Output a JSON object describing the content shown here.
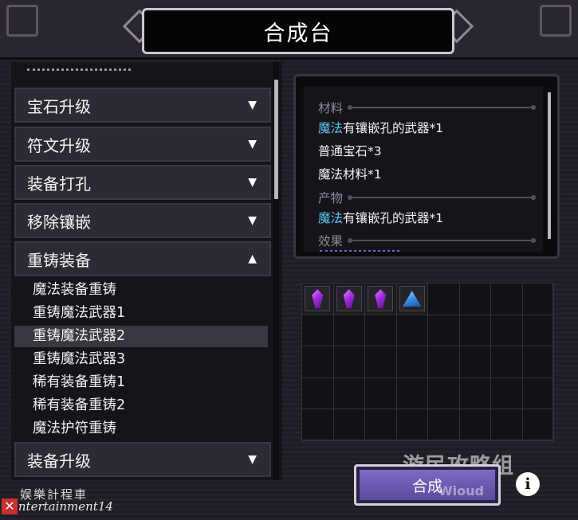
{
  "window": {
    "title": "合成台"
  },
  "categories": [
    {
      "label": "宝石升级",
      "arrow": "▼"
    },
    {
      "label": "符文升级",
      "arrow": "▼"
    },
    {
      "label": "装备打孔",
      "arrow": "▼"
    },
    {
      "label": "移除镶嵌",
      "arrow": "▼"
    },
    {
      "label": "重铸装备",
      "arrow": "▲"
    },
    {
      "label": "装备升级",
      "arrow": "▼"
    }
  ],
  "recipes": [
    {
      "label": "魔法装备重铸",
      "selected": false
    },
    {
      "label": "重铸魔法武器1",
      "selected": false
    },
    {
      "label": "重铸魔法武器2",
      "selected": true
    },
    {
      "label": "重铸魔法武器3",
      "selected": false
    },
    {
      "label": "稀有装备重铸1",
      "selected": false
    },
    {
      "label": "稀有装备重铸2",
      "selected": false
    },
    {
      "label": "魔法护符重铸",
      "selected": false
    }
  ],
  "details": {
    "materials_header": "材料",
    "material_1_prefix": "魔法",
    "material_1_rest": "有镶嵌孔的武器*1",
    "material_2": "普通宝石*3",
    "material_3": "魔法材料*1",
    "product_header": "产物",
    "product_1_prefix": "魔法",
    "product_1_rest": "有镶嵌孔的武器*1",
    "effect_header": "效果"
  },
  "inventory": [
    {
      "icon": "purple-gem-icon",
      "color": "#a22ee0"
    },
    {
      "icon": "purple-gem-icon",
      "color": "#a22ee0"
    },
    {
      "icon": "purple-gem-icon",
      "color": "#a22ee0"
    },
    {
      "icon": "blue-crystal-icon",
      "color": "#3a8ee8"
    }
  ],
  "craft_button": {
    "label": "合成"
  },
  "watermark": {
    "main": "游民攻略组",
    "sub": "Wioud"
  },
  "credit": {
    "cn": "娱樂計程車",
    "en": "entertainment14"
  },
  "colors": {
    "highlight": "#5ac8f0",
    "craft_button": "#6b5bb0"
  }
}
